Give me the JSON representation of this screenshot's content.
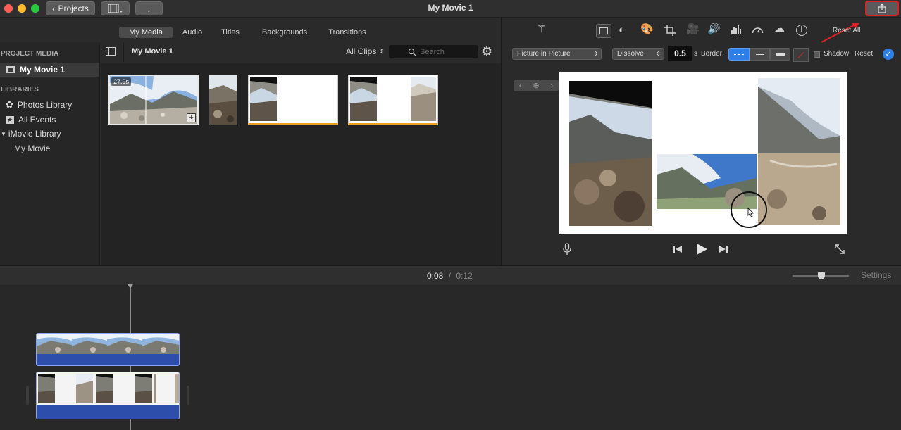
{
  "window": {
    "title": "My Movie 1",
    "projects_label": "Projects"
  },
  "colors": {
    "close": "#ff5f57",
    "minimize": "#febc2e",
    "zoom": "#28c840",
    "accent": "#2f7fe8",
    "highlight": "#e02020",
    "timeline_clip": "#2e4eac"
  },
  "media_tabs": [
    {
      "label": "My Media",
      "active": true
    },
    {
      "label": "Audio",
      "active": false
    },
    {
      "label": "Titles",
      "active": false
    },
    {
      "label": "Backgrounds",
      "active": false
    },
    {
      "label": "Transitions",
      "active": false
    }
  ],
  "sidebar": {
    "project_media_header": "PROJECT MEDIA",
    "project_item": "My Movie 1",
    "libraries_header": "LIBRARIES",
    "photos_library": "Photos Library",
    "all_events": "All Events",
    "imovie_library": "iMovie Library",
    "my_movie": "My Movie"
  },
  "browser": {
    "event_title": "My Movie 1",
    "all_clips": "All Clips",
    "search_placeholder": "Search",
    "first_clip_duration": "27.9s"
  },
  "adjust_toolbar": {
    "icons": [
      "magic-wand-icon",
      "video-overlay-icon",
      "color-balance-icon",
      "color-correction-icon",
      "crop-icon",
      "stabilization-icon",
      "volume-icon",
      "equalizer-icon",
      "speed-icon",
      "clip-filter-icon",
      "info-icon"
    ],
    "reset_all": "Reset All"
  },
  "overlay_controls": {
    "mode": "Picture in Picture",
    "transition": "Dissolve",
    "duration": "0.5",
    "duration_unit": "s",
    "border_label": "Border:",
    "shadow_label": "Shadow",
    "reset_label": "Reset"
  },
  "timeline": {
    "current_time": "0:08",
    "separator": "/",
    "total_time": "0:12",
    "settings_label": "Settings",
    "zoom_level": 0.52
  }
}
